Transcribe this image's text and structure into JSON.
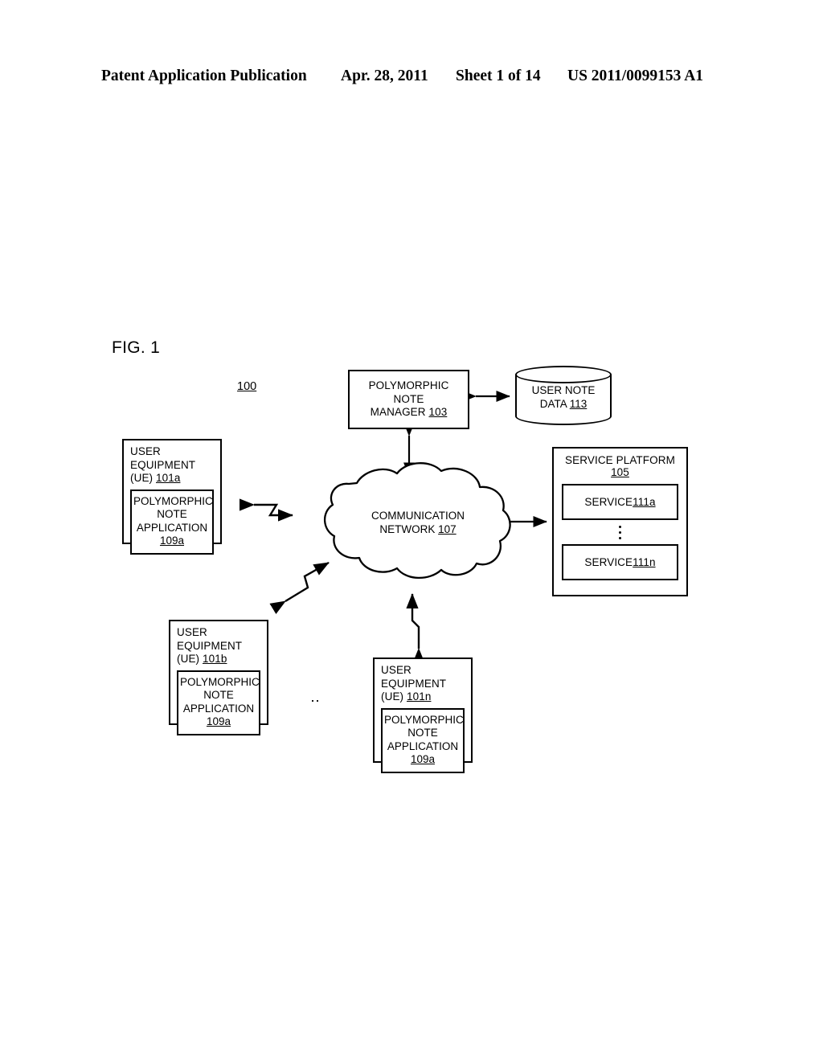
{
  "header": {
    "publication": "Patent Application Publication",
    "date": "Apr. 28, 2011",
    "sheet": "Sheet 1 of 14",
    "number": "US 2011/0099153 A1"
  },
  "figure": {
    "label": "FIG. 1",
    "system_ref": "100"
  },
  "nodes": {
    "manager": {
      "line1": "POLYMORPHIC NOTE",
      "line2": "MANAGER ",
      "ref": "103"
    },
    "database": {
      "line1": "USER NOTE",
      "line2": "DATA  ",
      "ref": "113"
    },
    "network": {
      "line1": "COMMUNICATION",
      "line2": "NETWORK ",
      "ref": "107"
    },
    "service_platform": {
      "title": "SERVICE PLATFORM ",
      "title_ref": "105",
      "services": [
        {
          "label": "SERVICE ",
          "ref": "111a"
        },
        {
          "label": "SERVICE ",
          "ref": "111n"
        }
      ],
      "vertical_ellipsis": "⋮"
    },
    "ue_a": {
      "title_line1": "USER EQUIPMENT",
      "title_line2": "(UE) ",
      "title_ref": "101a",
      "app_line1": "POLYMORPHIC",
      "app_line2": "NOTE",
      "app_line3": "APPLICATION",
      "app_ref": "109a"
    },
    "ue_b": {
      "title_line1": "USER EQUIPMENT",
      "title_line2": "(UE) ",
      "title_ref": "101b",
      "app_line1": "POLYMORPHIC",
      "app_line2": "NOTE",
      "app_line3": "APPLICATION",
      "app_ref": "109a"
    },
    "ue_n": {
      "title_line1": "USER EQUIPMENT",
      "title_line2": "(UE) ",
      "title_ref": "101n",
      "app_line1": "POLYMORPHIC",
      "app_line2": "NOTE",
      "app_line3": "APPLICATION",
      "app_ref": "109a"
    }
  },
  "ellipsis": {
    "between_ue_boxes": "‥"
  },
  "colors": {
    "ink": "#000000",
    "paper": "#ffffff"
  }
}
